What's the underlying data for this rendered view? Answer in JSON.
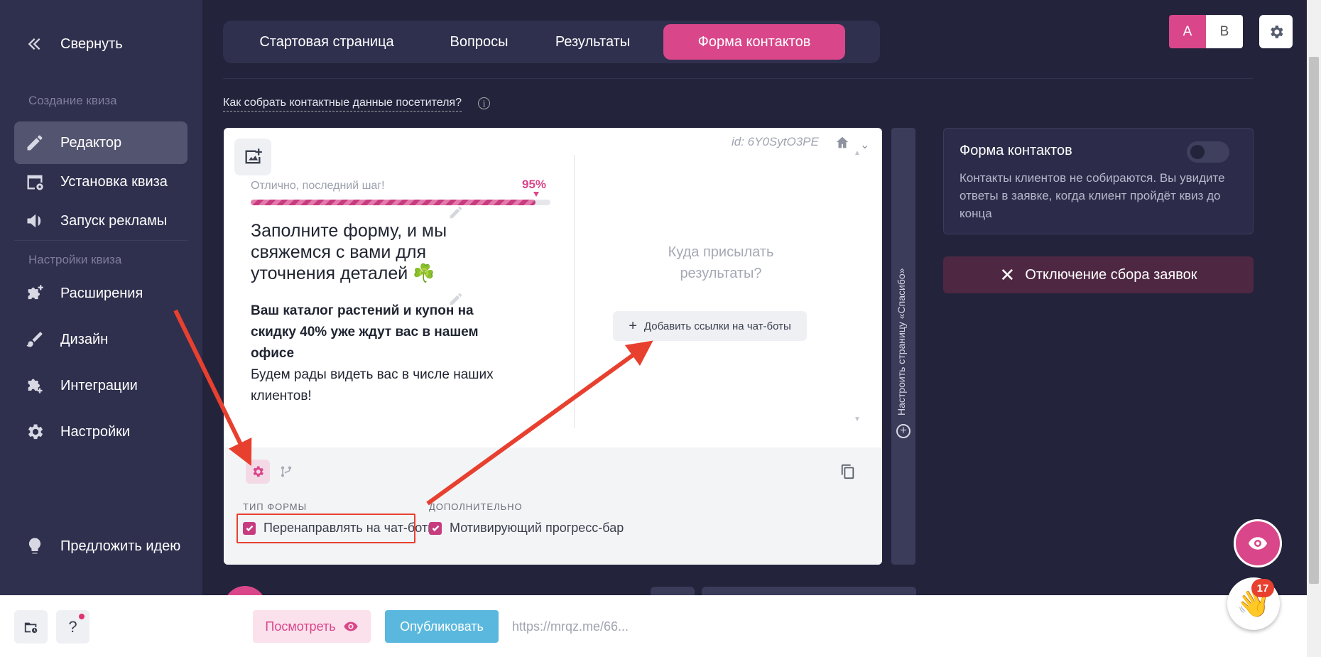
{
  "sidebar": {
    "collapse": "Свернуть",
    "section_create": "Создание квиза",
    "section_settings": "Настройки квиза",
    "items": [
      {
        "label": "Редактор"
      },
      {
        "label": "Установка квиза"
      },
      {
        "label": "Запуск рекламы"
      },
      {
        "label": "Расширения"
      },
      {
        "label": "Дизайн"
      },
      {
        "label": "Интеграции"
      },
      {
        "label": "Настройки"
      }
    ],
    "suggest": "Предложить идею"
  },
  "tabs": [
    {
      "label": "Стартовая страница"
    },
    {
      "label": "Вопросы"
    },
    {
      "label": "Результаты"
    },
    {
      "label": "Форма контактов"
    }
  ],
  "ab": {
    "a": "A",
    "b": "B"
  },
  "help_link": "Как собрать контактные данные посетителя?",
  "info_glyph": "i",
  "card": {
    "id": "id: 6Y0SytO3PE",
    "chevron": "⌄",
    "progress": {
      "label": "Отлично, последний шаг!",
      "percent": "95%",
      "value": 95
    },
    "title": "Заполните форму, и мы свяжемся с вами для уточнения деталей ☘️",
    "subtitle_bold": "Ваш каталог растений и купон на скидку 40% уже ждут вас в нашем офисе",
    "subtitle_rest": "Будем рады видеть вас в числе наших клиентов!",
    "right_question": "Куда присылать результаты?",
    "add_links_plus": "+",
    "add_links": "Добавить ссылки на чат-боты",
    "scroll_up": "▲",
    "scroll_down": "▼",
    "form_type_label": "ТИП ФОРМЫ",
    "extra_label": "ДОПОЛНИТЕЛЬНО",
    "redirect_checkbox": "Перенаправлять на чат-боты",
    "progress_checkbox": "Мотивирующий прогресс-бар"
  },
  "thanks_strip": "Настроить страницу «Спасибо»",
  "thanks_plus": "+",
  "contact_panel": {
    "title": "Форма контактов",
    "desc": "Контакты клиентов не собираются. Вы увидите ответы в заявке, когда клиент пройдёт квиз до конца"
  },
  "disable_btn": {
    "icon": "✕",
    "label": "Отключение сбора заявок"
  },
  "bottom": {
    "help": "?",
    "view": "Посмотреть",
    "publish": "Опубликовать",
    "url": "https://mrqz.me/66..."
  },
  "wave": {
    "emoji": "👋",
    "badge": "17"
  },
  "colors": {
    "accent": "#d9468a",
    "sidebar": "#2f2f4e",
    "bg": "#23233c",
    "arrow": "#e8402f",
    "publish": "#5ab8de"
  }
}
